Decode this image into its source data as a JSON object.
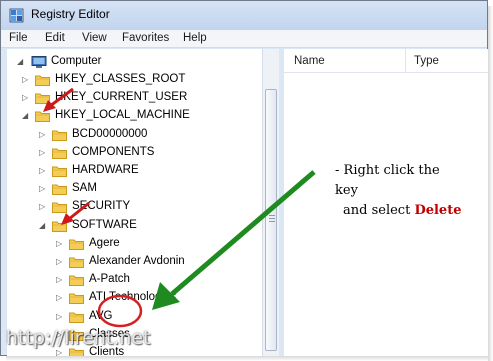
{
  "window": {
    "title": "Registry Editor"
  },
  "menu": [
    "File",
    "Edit",
    "View",
    "Favorites",
    "Help"
  ],
  "list_columns": [
    "Name",
    "Type"
  ],
  "tree": {
    "computer": "Computer",
    "root_keys": [
      "HKEY_CLASSES_ROOT",
      "HKEY_CURRENT_USER",
      "HKEY_LOCAL_MACHINE"
    ],
    "hklm_children": [
      "BCD00000000",
      "COMPONENTS",
      "HARDWARE",
      "SAM",
      "SECURITY",
      "SOFTWARE"
    ],
    "software_children": [
      "Agere",
      "Alexander Avdonin",
      "A-Patch",
      "ATI Technologies",
      "AVG",
      "Classes",
      "Clients"
    ]
  },
  "annotation": {
    "line1": "- Right click the key",
    "line2_prefix": "and select ",
    "line2_action": "Delete"
  },
  "watermark": "http://lirent.net",
  "colors": {
    "accent_arrow": "#cc1a1a",
    "pointer_arrow": "#1f8a1f",
    "highlight_circle": "#d42020",
    "delete_text": "#c00000"
  }
}
